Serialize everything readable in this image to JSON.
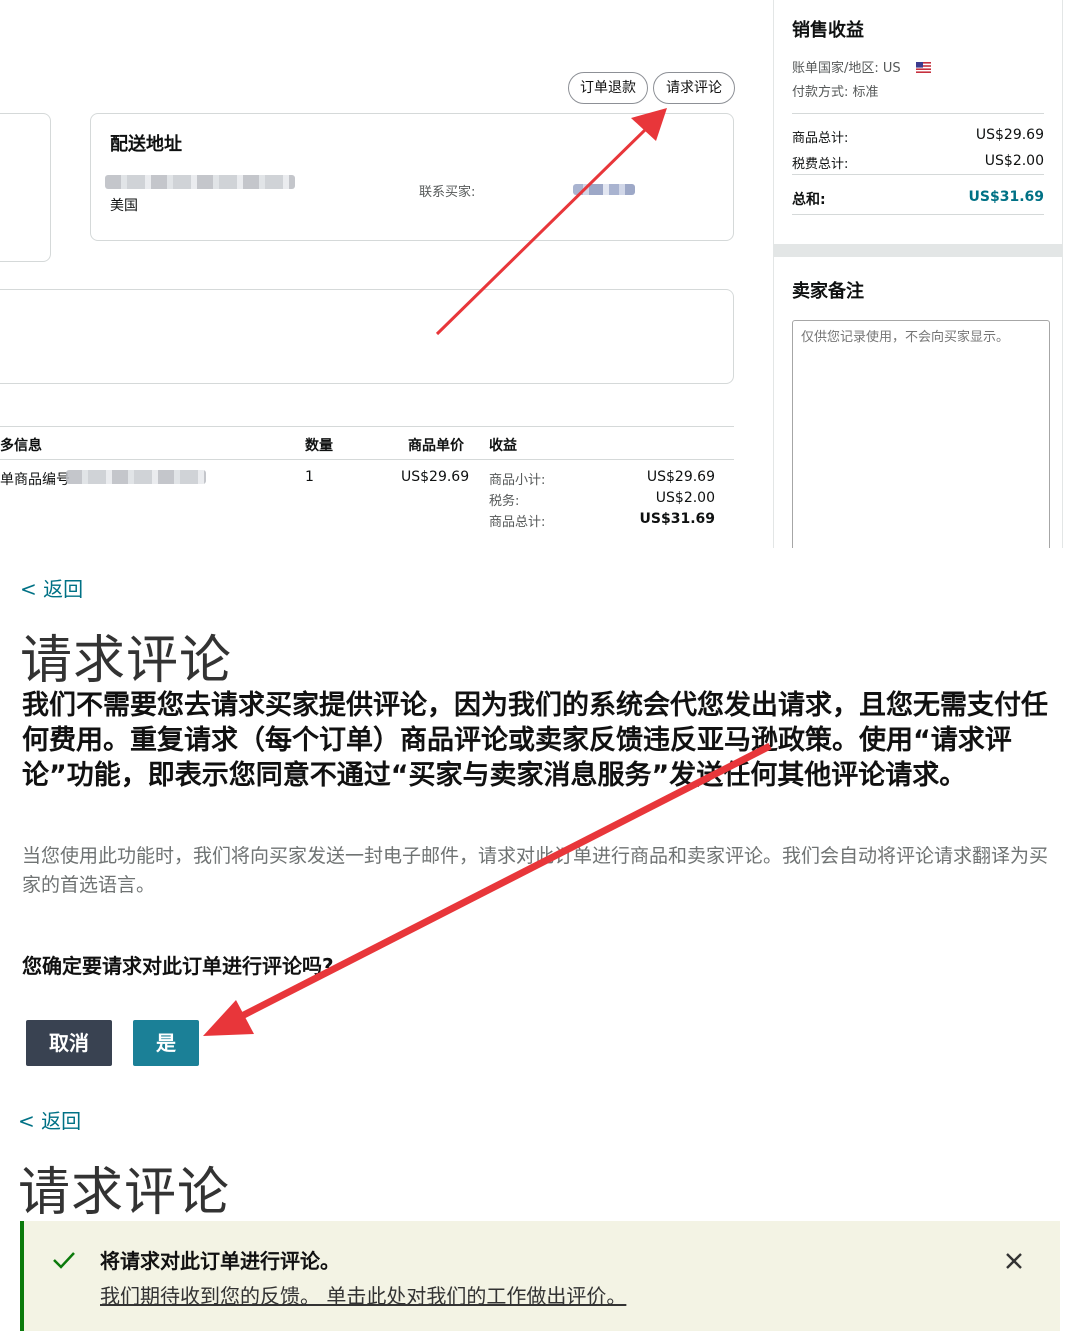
{
  "order_page": {
    "actions": {
      "refund_label": "订单退款",
      "review_label": "请求评论"
    },
    "shipping": {
      "title": "配送地址",
      "country": "美国",
      "contact_label": "联系买家:"
    },
    "table": {
      "headers": [
        "多信息",
        "数量",
        "商品单价",
        "收益"
      ],
      "row": {
        "item_label": "单商品编号",
        "quantity": "1",
        "unit_price": "US$29.69",
        "breakdown": [
          {
            "label": "商品小计:",
            "value": "US$29.69"
          },
          {
            "label": "税务:",
            "value": "US$2.00"
          },
          {
            "label": "商品总计:",
            "value": "US$31.69"
          }
        ]
      }
    },
    "sales": {
      "title": "销售收益",
      "billing_country": "账单国家/地区: US",
      "payment_method": "付款方式: 标准",
      "subtotal_label": "商品总计:",
      "subtotal_value": "US$29.69",
      "tax_label": "税费总计:",
      "tax_value": "US$2.00",
      "total_label": "总和:",
      "total_value": "US$31.69"
    },
    "seller_notes": {
      "title": "卖家备注",
      "placeholder": "仅供您记录使用，不会向买家显示。"
    }
  },
  "request_dialog": {
    "back_label": "< 返回",
    "title": "请求评论",
    "notice": "我们不需要您去请求买家提供评论，因为我们的系统会代您发出请求，且您无需支付任何费用。重复请求（每个订单）商品评论或卖家反馈违反亚马逊政策。使用“请求评论”功能，即表示您同意不通过“买家与卖家消息服务”发送任何其他评论请求。",
    "description": "当您使用此功能时，我们将向买家发送一封电子邮件，请求对此订单进行商品和卖家评论。我们会自动将评论请求翻译为买家的首选语言。",
    "confirm_question": "您确定要请求对此订单进行评论吗?",
    "cancel_label": "取消",
    "yes_label": "是"
  },
  "result": {
    "back_label": "< 返回",
    "title": "请求评论",
    "success_title": "将请求对此订单进行评论。",
    "feedback_link": "我们期待收到您的反馈。 单击此处对我们的工作做出评价。"
  },
  "icons": [
    "us-flag-icon",
    "check-icon",
    "close-icon",
    "annotation-arrow"
  ],
  "colors": {
    "link": "#007185",
    "cancel_button": "#394251",
    "yes_button": "#1b8097",
    "success_border": "#0b7a0b",
    "success_bg": "#f3f3e4",
    "arrow": "#e8363a"
  }
}
